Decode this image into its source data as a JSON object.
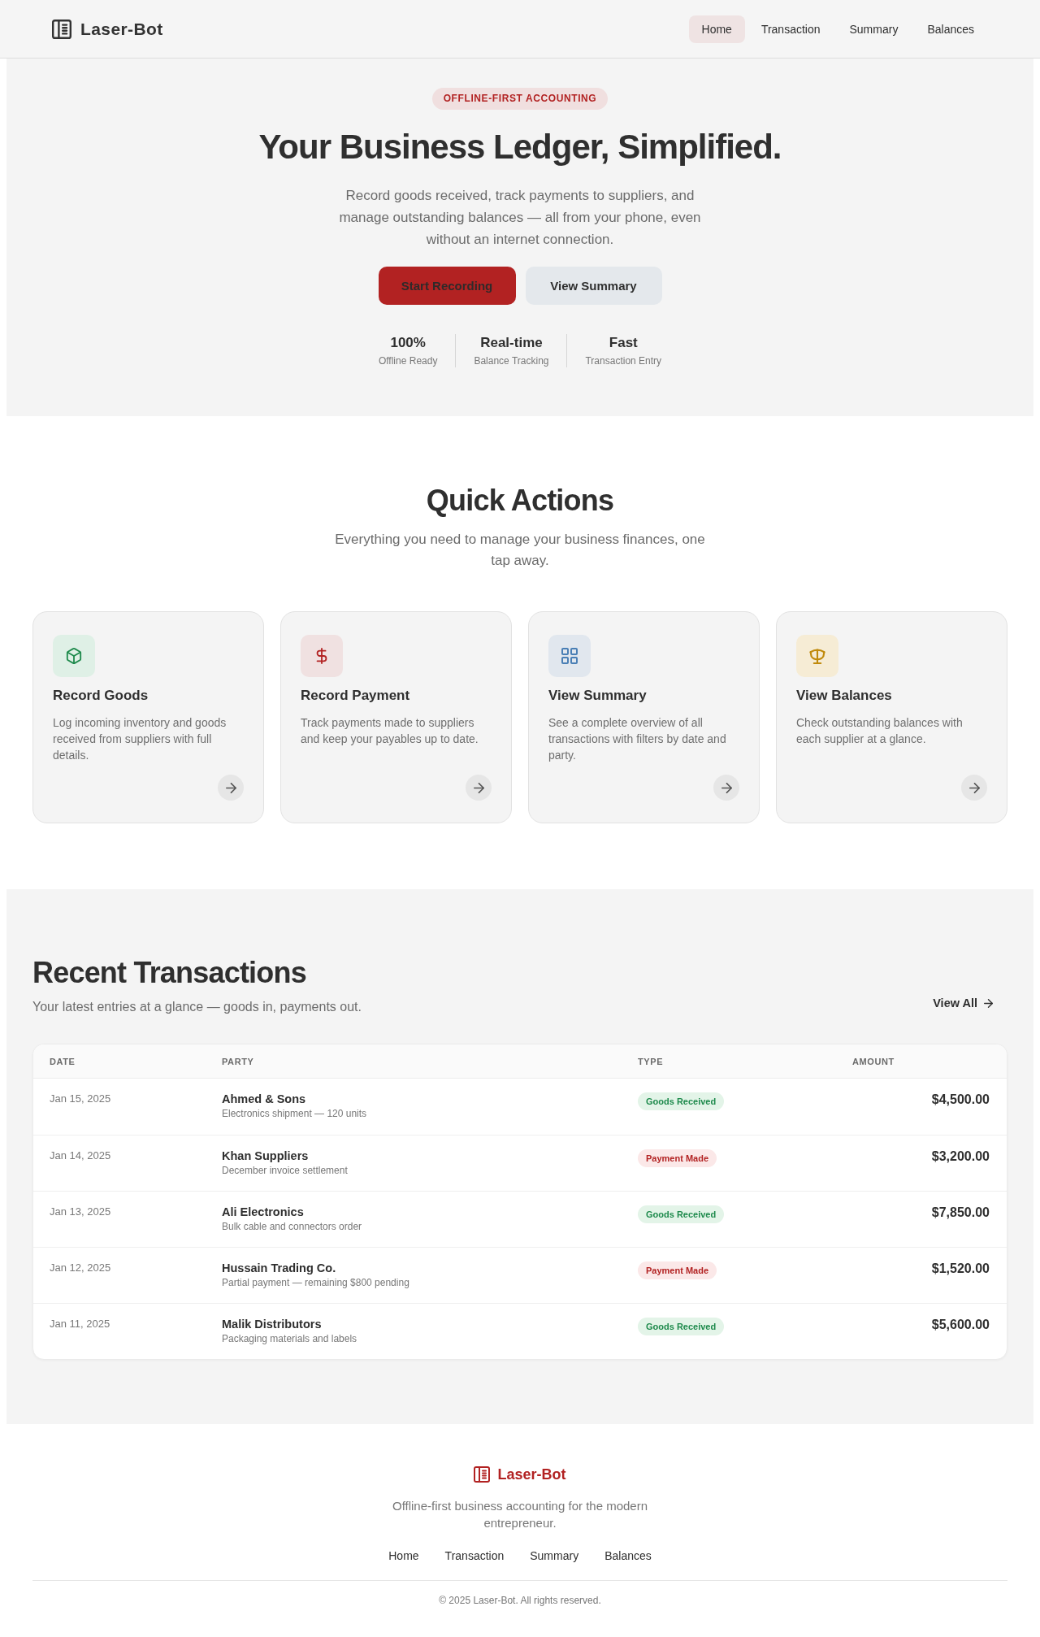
{
  "header": {
    "brand": "Laser-Bot",
    "nav": [
      {
        "label": "Home",
        "selected": true
      },
      {
        "label": "Transaction",
        "selected": false
      },
      {
        "label": "Summary",
        "selected": false
      },
      {
        "label": "Balances",
        "selected": false
      }
    ]
  },
  "hero": {
    "badge": "OFFLINE-FIRST ACCOUNTING",
    "title": "Your Business Ledger, Simplified.",
    "description": "Record goods received, track payments to suppliers, and manage outstanding balances — all from your phone, even without an internet connection.",
    "buttons": [
      {
        "label": "Start Recording",
        "kind": "primary"
      },
      {
        "label": "View Summary",
        "kind": "secondary"
      }
    ],
    "stats": [
      {
        "value": "100%",
        "label": "Offline Ready"
      },
      {
        "value": "Real-time",
        "label": "Balance Tracking"
      },
      {
        "value": "Fast",
        "label": "Transaction Entry"
      }
    ]
  },
  "quick_actions": {
    "title": "Quick Actions",
    "subtitle": "Everything you need to manage your business finances, one tap away.",
    "cards": [
      {
        "kind": "goods",
        "title": "Record Goods",
        "description": "Log incoming inventory and goods received from suppliers with full details."
      },
      {
        "kind": "payment",
        "title": "Record Payment",
        "description": "Track payments made to suppliers and keep your payables up to date."
      },
      {
        "kind": "summary",
        "title": "View Summary",
        "description": "See a complete overview of all transactions with filters by date and party."
      },
      {
        "kind": "balances",
        "title": "View Balances",
        "description": "Check outstanding balances with each supplier at a glance."
      }
    ]
  },
  "recent_transactions": {
    "title": "Recent Transactions",
    "subtitle": "Your latest entries at a glance — goods in, payments out.",
    "view_all": "View All",
    "columns": [
      "DATE",
      "PARTY",
      "TYPE",
      "AMOUNT"
    ],
    "rows": [
      {
        "date": "Jan 15, 2025",
        "party": "Ahmed & Sons",
        "note": "Electronics shipment — 120 units",
        "kind": "goods",
        "type": "Goods Received",
        "amount": "$4,500.00"
      },
      {
        "date": "Jan 14, 2025",
        "party": "Khan Suppliers",
        "note": "December invoice settlement",
        "kind": "payment",
        "type": "Payment Made",
        "amount": "$3,200.00"
      },
      {
        "date": "Jan 13, 2025",
        "party": "Ali Electronics",
        "note": "Bulk cable and connectors order",
        "kind": "goods",
        "type": "Goods Received",
        "amount": "$7,850.00"
      },
      {
        "date": "Jan 12, 2025",
        "party": "Hussain Trading Co.",
        "note": "Partial payment — remaining $800 pending",
        "kind": "payment",
        "type": "Payment Made",
        "amount": "$1,520.00"
      },
      {
        "date": "Jan 11, 2025",
        "party": "Malik Distributors",
        "note": "Packaging materials and labels",
        "kind": "goods",
        "type": "Goods Received",
        "amount": "$5,600.00"
      }
    ]
  },
  "footer": {
    "brand": "Laser-Bot",
    "tagline": "Offline-first business accounting for the modern entrepreneur.",
    "links": [
      "Home",
      "Transaction",
      "Summary",
      "Balances"
    ],
    "copyright": "© 2025 Laser-Bot. All rights reserved."
  }
}
